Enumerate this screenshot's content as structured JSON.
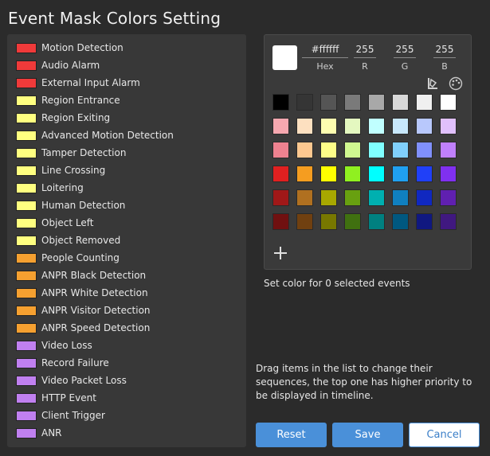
{
  "window": {
    "title": "Event Mask Colors Setting"
  },
  "events": [
    {
      "label": "Motion Detection",
      "color": "#f03a3a"
    },
    {
      "label": "Audio Alarm",
      "color": "#f03a3a"
    },
    {
      "label": "External Input Alarm",
      "color": "#f03a3a"
    },
    {
      "label": "Region Entrance",
      "color": "#ffff80"
    },
    {
      "label": "Region Exiting",
      "color": "#ffff80"
    },
    {
      "label": "Advanced Motion Detection",
      "color": "#ffff80"
    },
    {
      "label": "Tamper Detection",
      "color": "#ffff80"
    },
    {
      "label": "Line Crossing",
      "color": "#ffff80"
    },
    {
      "label": "Loitering",
      "color": "#ffff80"
    },
    {
      "label": "Human Detection",
      "color": "#ffff80"
    },
    {
      "label": "Object Left",
      "color": "#ffff80"
    },
    {
      "label": "Object Removed",
      "color": "#ffff80"
    },
    {
      "label": "People Counting",
      "color": "#f5a030"
    },
    {
      "label": "ANPR Black Detection",
      "color": "#f5a030"
    },
    {
      "label": "ANPR White Detection",
      "color": "#f5a030"
    },
    {
      "label": "ANPR Visitor Detection",
      "color": "#f5a030"
    },
    {
      "label": "ANPR Speed Detection",
      "color": "#f5a030"
    },
    {
      "label": "Video Loss",
      "color": "#c080f0"
    },
    {
      "label": "Record Failure",
      "color": "#c080f0"
    },
    {
      "label": "Video Packet Loss",
      "color": "#c080f0"
    },
    {
      "label": "HTTP Event",
      "color": "#c080f0"
    },
    {
      "label": "Client Trigger",
      "color": "#c080f0"
    },
    {
      "label": "ANR",
      "color": "#c080f0"
    }
  ],
  "picker": {
    "preview_color": "#ffffff",
    "hex": {
      "value": "#ffffff",
      "label": "Hex"
    },
    "r": {
      "value": "255",
      "label": "R"
    },
    "g": {
      "value": "255",
      "label": "G"
    },
    "b": {
      "value": "255",
      "label": "B"
    },
    "icons": [
      "fill-bucket-icon",
      "palette-icon",
      "add-icon"
    ],
    "palette": [
      [
        "#000000",
        "#353535",
        "#555555",
        "#7a7a7a",
        "#a8a8a8",
        "#d8d8d8",
        "#f0f0f0",
        "#ffffff"
      ],
      [
        "#f6a8b0",
        "#fde0c0",
        "#fdfdb0",
        "#e4f8c0",
        "#c0ffff",
        "#c8e8fc",
        "#b8c8fc",
        "#e0c0fc"
      ],
      [
        "#ee8290",
        "#fdc890",
        "#fdfd88",
        "#d0f890",
        "#80ffff",
        "#80d0fc",
        "#8090fc",
        "#c080fc"
      ],
      [
        "#e02020",
        "#f59d20",
        "#ffff00",
        "#90f020",
        "#00ffff",
        "#20a0f0",
        "#2040f8",
        "#8030f0"
      ],
      [
        "#a01818",
        "#b07020",
        "#a8a800",
        "#68a010",
        "#00b0b0",
        "#1080c0",
        "#1028c0",
        "#6020b0"
      ],
      [
        "#701010",
        "#704010",
        "#787800",
        "#407010",
        "#008080",
        "#005880",
        "#101880",
        "#401880"
      ]
    ]
  },
  "status": {
    "selected_text": "Set color for 0 selected events"
  },
  "hint": {
    "text": "Drag items in the list to change their sequences, the top one has higher priority to be displayed in timeline."
  },
  "buttons": {
    "reset": "Reset",
    "save": "Save",
    "cancel": "Cancel"
  }
}
